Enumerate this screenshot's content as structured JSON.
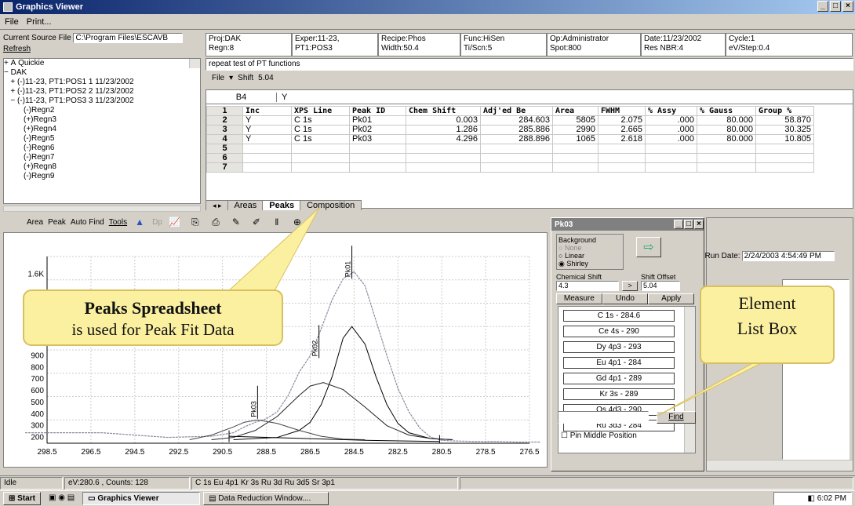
{
  "window": {
    "title": "Graphics Viewer",
    "min": "_",
    "max": "□",
    "close": "×"
  },
  "menu": {
    "file": "File",
    "print": "Print..."
  },
  "source": {
    "label": "Current  Source File",
    "path": "C:\\Program Files\\ESCAVB",
    "refresh": "Refresh"
  },
  "tree": [
    "+ A Quickie",
    "− DAK",
    "   + (-)11-23, PT1:POS1 1 11/23/2002",
    "   + (-)11-23, PT1:POS2 2 11/23/2002",
    "   − (-)11-23, PT1:POS3 3 11/23/2002",
    "         (-)Regn2",
    "         (+)Regn3",
    "         (+)Regn4",
    "         (-)Regn5",
    "         (-)Regn6",
    "         (-)Regn7",
    "         (+)Regn8",
    "         (-)Regn9"
  ],
  "info": {
    "proj": "Proj:DAK",
    "regn": "Regn:8",
    "exper": "Exper:11-23,",
    "pt": "PT1:POS3",
    "recipe": "Recipe:Phos",
    "width": "Width:50.4",
    "func": "Func:HiSen",
    "ti": "Ti/Scn:5",
    "op": "Op:Administrator",
    "spot": "Spot:800",
    "date": "Date:11/23/2002",
    "res": "Res NBR:4",
    "cycle": "Cycle:1",
    "ev": "eV/Step:0.4"
  },
  "comment": "repeat test of PT functions",
  "sheet_toolbar": {
    "file": "File",
    "shift_label": "Shift",
    "shift_value": "5.04"
  },
  "cell_ref": "B4",
  "cell_value": "Y",
  "table": {
    "headers": [
      "Inc",
      "XPS Line",
      "Peak ID",
      "Chem Shift",
      "Adj'ed Be",
      "Area",
      "FWHM",
      "% Assy",
      "% Gauss",
      "Group %"
    ],
    "rows": [
      [
        "Y",
        "C 1s",
        "Pk01",
        "0.003",
        "284.603",
        "5805",
        "2.075",
        ".000",
        "80.000",
        "58.870"
      ],
      [
        "Y",
        "C 1s",
        "Pk02",
        "1.286",
        "285.886",
        "2990",
        "2.665",
        ".000",
        "80.000",
        "30.325"
      ],
      [
        "Y",
        "C 1s",
        "Pk03",
        "4.296",
        "288.896",
        "1065",
        "2.618",
        ".000",
        "80.000",
        "10.805"
      ]
    ],
    "row_numbers": [
      "1",
      "2",
      "3",
      "4",
      "5",
      "6",
      "7"
    ]
  },
  "tabs": [
    "Areas",
    "Peaks",
    "Composition"
  ],
  "chart_toolbar": {
    "area": "Area",
    "peak": "Peak",
    "autofind": "Auto Find",
    "tools": "Tools",
    "dp": "Dp"
  },
  "chart_data": {
    "type": "line",
    "x_ticks": [
      "298.5",
      "296.5",
      "294.5",
      "292.5",
      "290.5",
      "288.5",
      "286.5",
      "284.5",
      "282.5",
      "280.5",
      "278.5",
      "276.5"
    ],
    "y_ticks": [
      "1.6K",
      "900",
      "800",
      "700",
      "600",
      "500",
      "400",
      "300",
      "200"
    ],
    "xlim": [
      298.5,
      276.5
    ],
    "ylim": [
      150,
      1750
    ],
    "peak_labels": [
      "Pk01",
      "Pk02",
      "Pk03"
    ],
    "series": [
      {
        "name": "",
        "x": [
          299.5,
          296,
          293,
          291,
          290,
          289.5,
          289,
          288.5,
          288,
          287.5,
          287,
          286.5,
          286,
          285.5,
          285,
          284.5,
          284,
          283.5,
          283,
          282.5,
          282,
          281.5,
          281,
          280.5,
          280,
          279,
          278,
          277,
          276
        ],
        "y": [
          240,
          240,
          200,
          210,
          240,
          290,
          330,
          360,
          420,
          560,
          760,
          900,
          1130,
          1380,
          1560,
          1620,
          1500,
          1200,
          900,
          620,
          420,
          280,
          200,
          175,
          170,
          165,
          165,
          160,
          160
        ]
      },
      {
        "name": "Pk01",
        "x": [
          290,
          288,
          287,
          286.5,
          286,
          285.5,
          285,
          284.6,
          284,
          283.5,
          283,
          282.5,
          282,
          281,
          280
        ],
        "y": [
          180,
          200,
          260,
          330,
          480,
          720,
          1050,
          1150,
          1000,
          720,
          480,
          320,
          240,
          190,
          180
        ]
      },
      {
        "name": "Pk02",
        "x": [
          291,
          290,
          289,
          288,
          287,
          286.5,
          285.9,
          285,
          284,
          283,
          282,
          281,
          280
        ],
        "y": [
          180,
          200,
          260,
          380,
          560,
          640,
          670,
          610,
          460,
          300,
          220,
          190,
          180
        ]
      },
      {
        "name": "Pk03",
        "x": [
          292,
          291,
          290,
          289.5,
          288.9,
          288,
          287,
          286,
          285,
          284
        ],
        "y": [
          180,
          220,
          290,
          330,
          350,
          320,
          260,
          210,
          185,
          180
        ]
      }
    ]
  },
  "dialog": {
    "title": "Pk03",
    "background_label": "Background",
    "bg_none": "None",
    "bg_linear": "Linear",
    "bg_shirley": "Shirley",
    "chem_shift_label": "Chemical Shift",
    "chem_shift_value": "4.3",
    "shift_offset_label": "Shift Offset",
    "shift_offset_value": "5.04",
    "arrow": ">",
    "measure": "Measure",
    "undo": "Undo",
    "apply": "Apply",
    "elements": [
      "C 1s - 284.6",
      "Ce 4s - 290",
      "Dy 4p3 - 293",
      "Eu 4p1 - 284",
      "Gd 4p1 - 289",
      "Kr 3s - 289",
      "Os 4d3 - 290",
      "Ru 3d3 - 284"
    ],
    "find": "Find",
    "pin": "Pin Middle Position"
  },
  "right": {
    "run_date": "t Run Date:",
    "run_date_value": "2/24/2003 4:54:49 PM"
  },
  "callouts": {
    "peaks_title": "Peaks Spreadsheet",
    "peaks_sub": "is used for Peak Fit Data",
    "element_1": "Element",
    "element_2": "List Box"
  },
  "status": {
    "state": "Idle",
    "readout": "eV:280.6 , Counts: 128",
    "elements": "C 1s  Eu 4p1  Kr 3s  Ru 3d  Ru 3d5  Sr 3p1"
  },
  "taskbar": {
    "start": "Start",
    "task1": "Graphics Viewer",
    "task2": "Data Reduction Window....",
    "time": "6:02 PM"
  },
  "colors": {
    "title_bar": "#0a246a",
    "callout_fill": "#fbf0a0",
    "callout_border": "#d8c060"
  }
}
